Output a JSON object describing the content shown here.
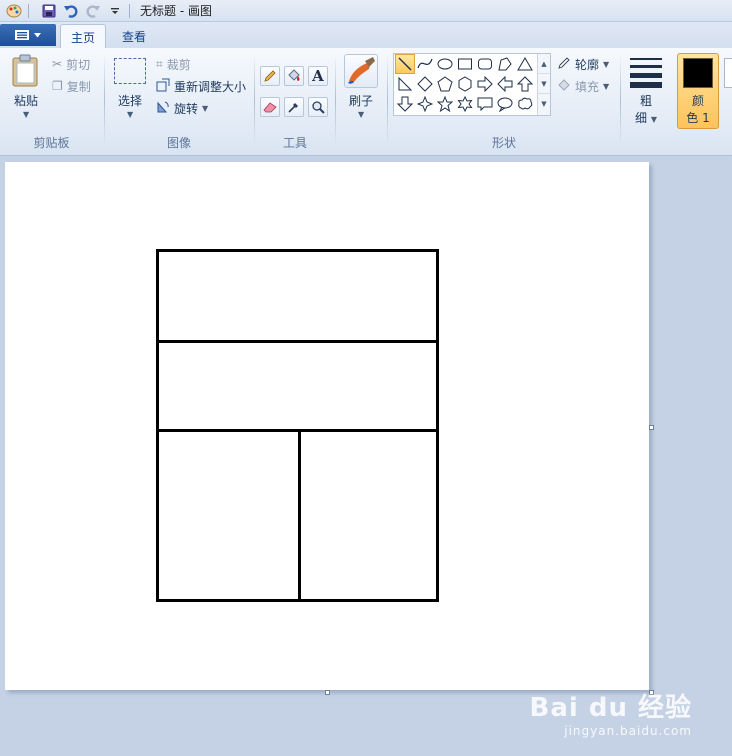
{
  "window": {
    "title": "无标题 - 画图"
  },
  "tabs": [
    {
      "label": "主页"
    },
    {
      "label": "查看"
    }
  ],
  "clipboard": {
    "paste": "粘贴",
    "cut": "剪切",
    "copy": "复制",
    "label": "剪贴板"
  },
  "image": {
    "select": "选择",
    "crop": "裁剪",
    "resize": "重新调整大小",
    "rotate": "旋转",
    "label": "图像"
  },
  "tools": {
    "label": "工具"
  },
  "brushes": {
    "label": "刷子"
  },
  "shapes": {
    "outline": "轮廓",
    "fill": "填充",
    "label": "形状"
  },
  "size": {
    "label_1": "粗",
    "label_2": "细"
  },
  "color1": {
    "label_1": "颜",
    "label_2": "色 1",
    "value": "#000000"
  },
  "watermark": {
    "main": "Bai du 经验",
    "sub": "jingyan.baidu.com"
  }
}
